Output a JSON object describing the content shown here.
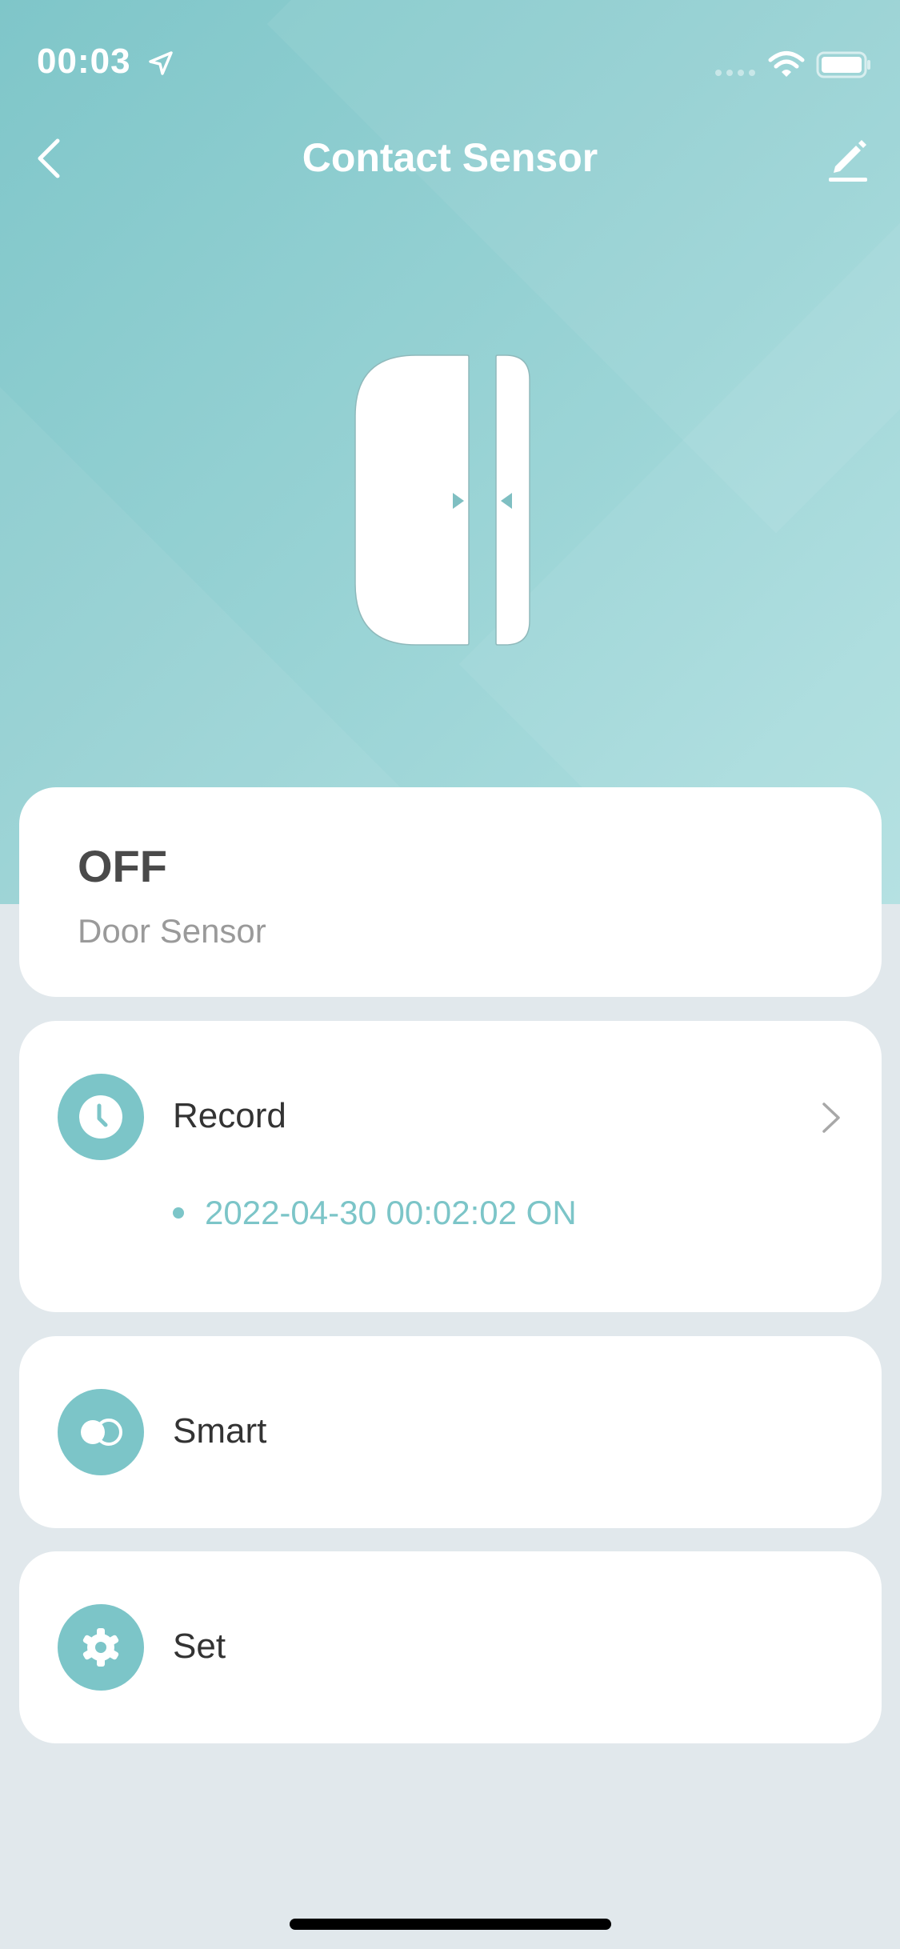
{
  "status_bar": {
    "time": "00:03",
    "icons": [
      "location-arrow-icon",
      "signal-icon",
      "wifi-icon",
      "battery-icon"
    ]
  },
  "nav": {
    "title": "Contact Sensor",
    "back_icon": "chevron-left-icon",
    "edit_icon": "pencil-icon"
  },
  "device": {
    "illustration": "contact-sensor-illustration",
    "state": "OFF",
    "type": "Door Sensor"
  },
  "menu": {
    "record": {
      "label": "Record",
      "icon": "clock-icon",
      "latest_entry": "2022-04-30 00:02:02 ON"
    },
    "smart": {
      "label": "Smart",
      "icon": "toggle-circles-icon"
    },
    "set": {
      "label": "Set",
      "icon": "gear-icon"
    }
  },
  "colors": {
    "accent": "#7cc5c8",
    "hero_start": "#7fc6c9",
    "hero_end": "#b1e0e1",
    "page_background": "#e1e8ec",
    "card": "#ffffff"
  }
}
